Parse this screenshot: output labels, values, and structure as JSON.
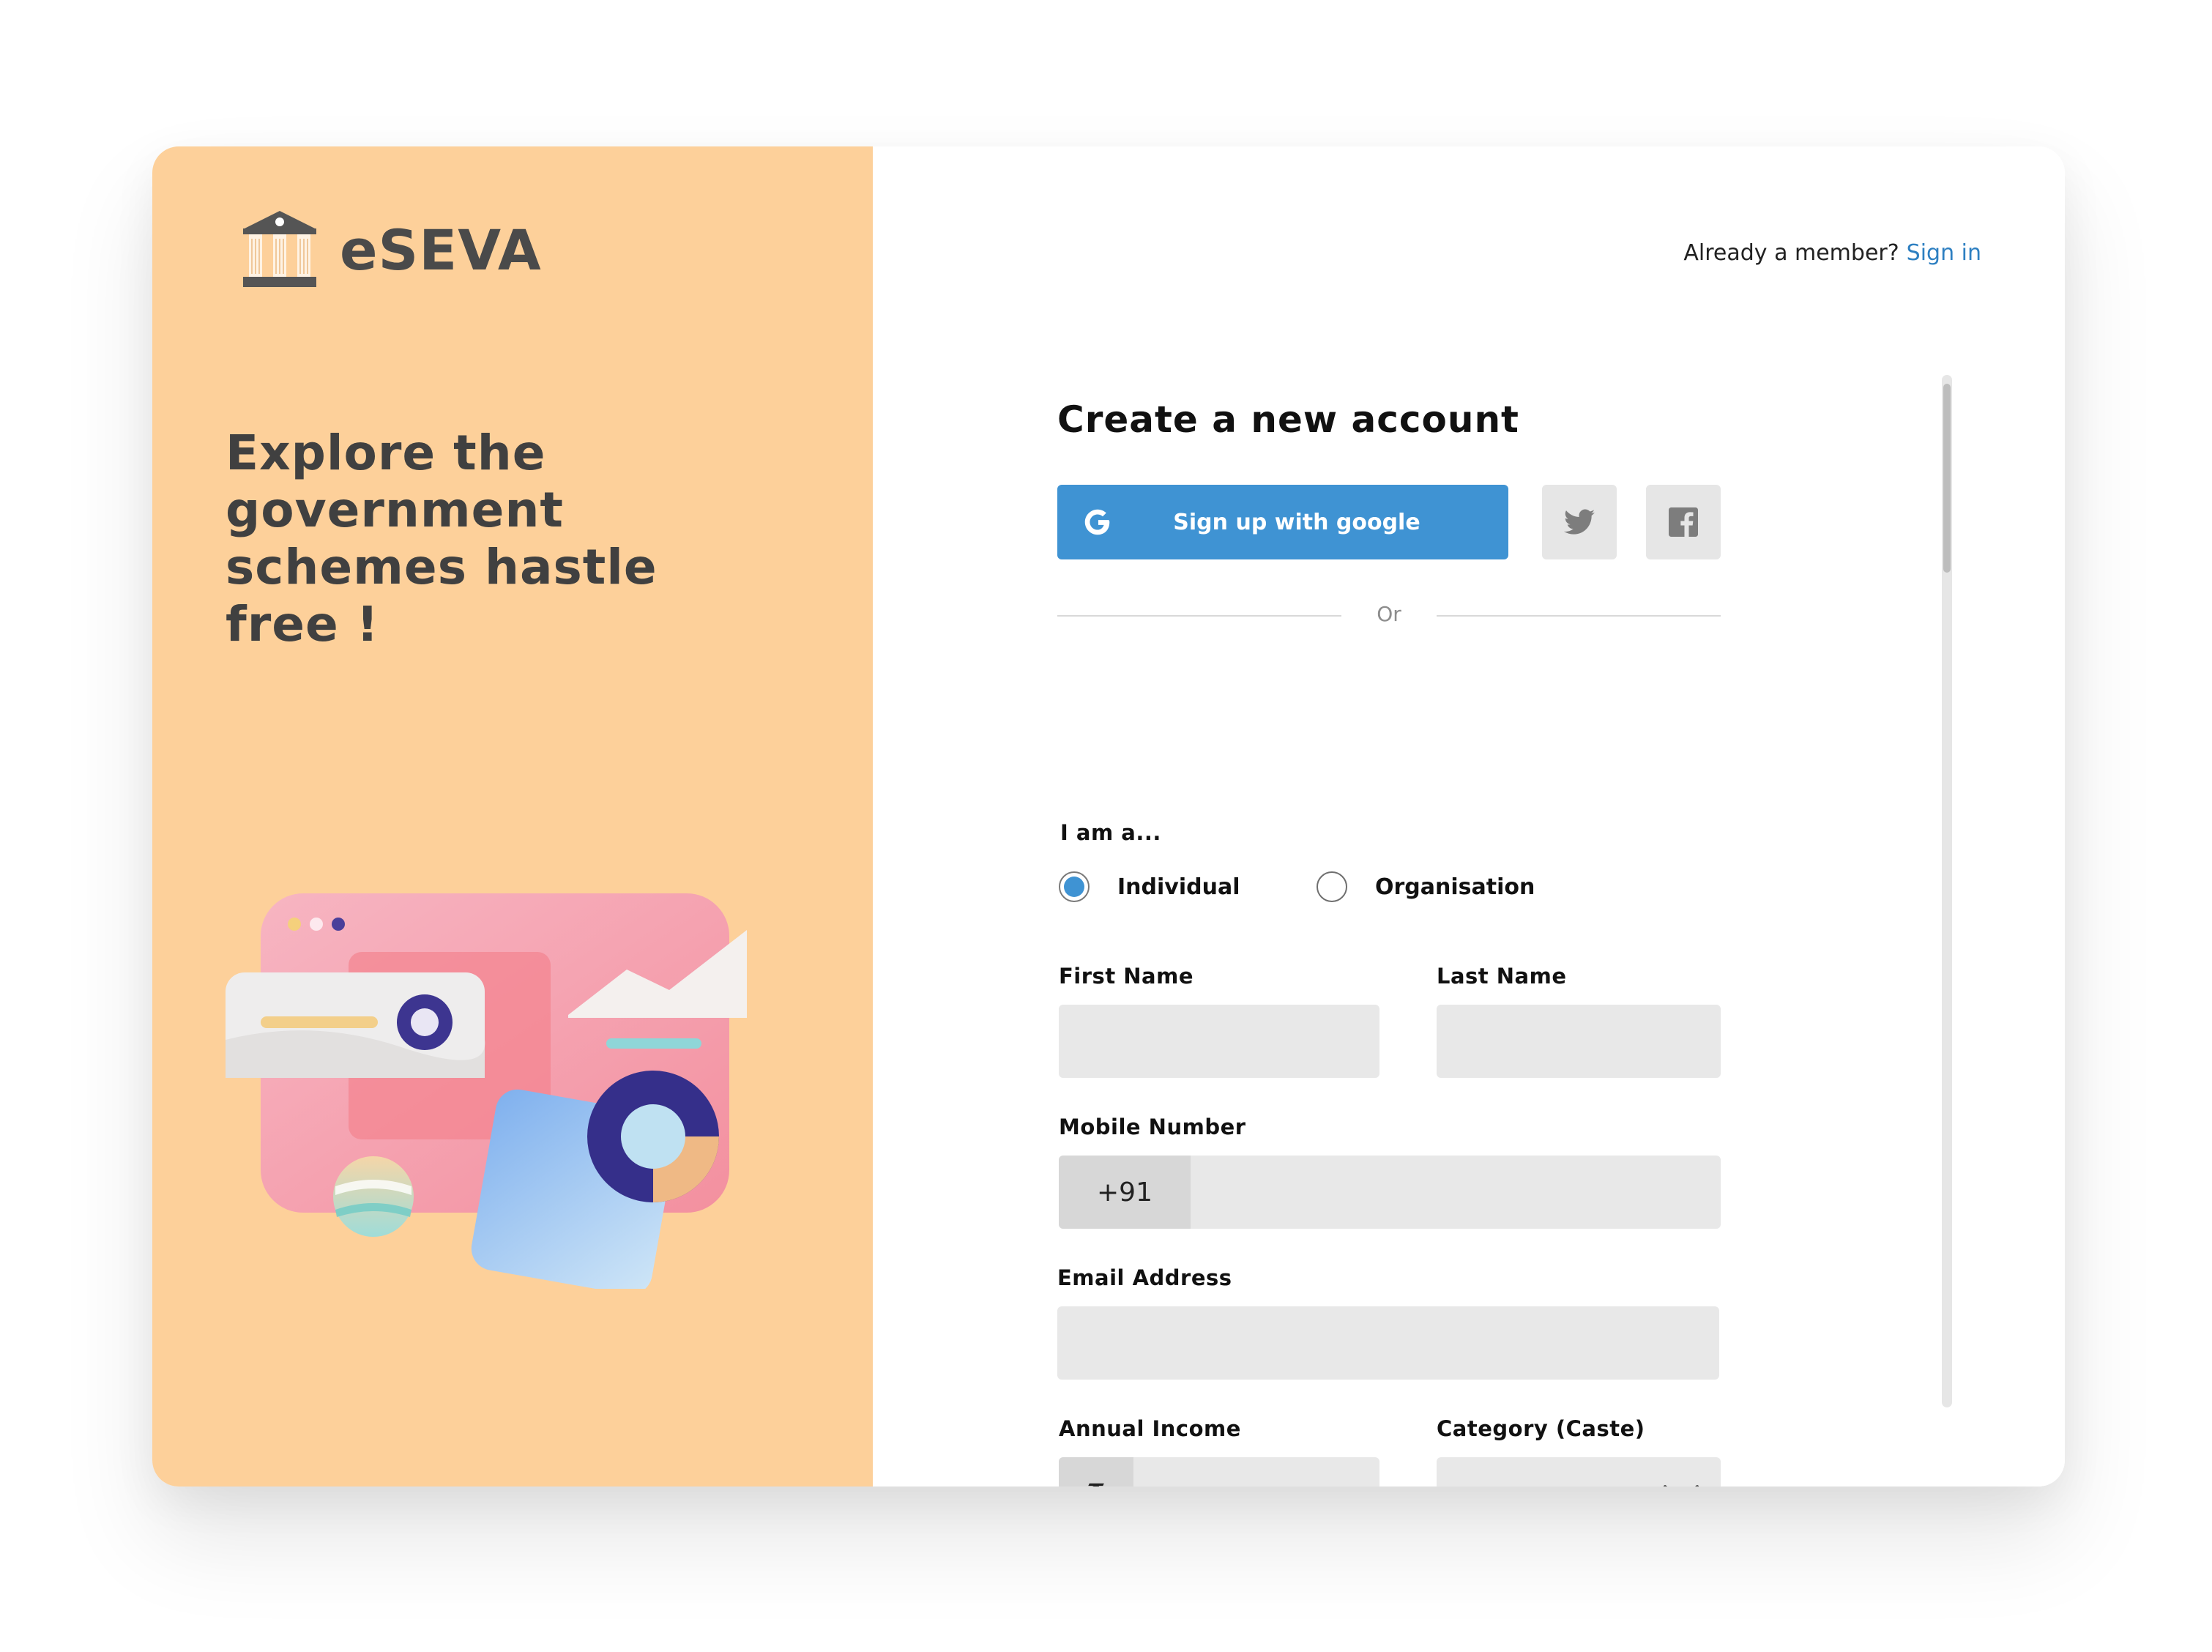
{
  "brand": {
    "name": "eSEVA",
    "logo_icon": "bank-building-icon"
  },
  "hero": {
    "tagline": "Explore the government schemes hastle free !"
  },
  "header": {
    "member_prompt": "Already a member?",
    "signin_label": "Sign in"
  },
  "form": {
    "title": "Create a new account",
    "google_button_label": "Sign up with google",
    "google_icon": "google-icon",
    "twitter_icon": "twitter-icon",
    "facebook_icon": "facebook-icon",
    "divider_text": "Or",
    "account_type": {
      "label": "I am a...",
      "options": [
        {
          "label": "Individual",
          "selected": true
        },
        {
          "label": "Organisation",
          "selected": false
        }
      ]
    },
    "first_name": {
      "label": "First Name",
      "value": ""
    },
    "last_name": {
      "label": "Last Name",
      "value": ""
    },
    "mobile": {
      "label": "Mobile Number",
      "prefix": "+91",
      "value": ""
    },
    "email": {
      "label": "Email Address",
      "value": ""
    },
    "income": {
      "label": "Annual Income",
      "prefix": "₹",
      "value": ""
    },
    "category": {
      "label": "Category (Caste)",
      "value": "",
      "icon": "chevron-down-icon"
    }
  },
  "colors": {
    "left_panel": "#fdd09a",
    "accent": "#3f93d3",
    "link": "#2d7fc1",
    "field_bg": "#e8e8e8"
  }
}
